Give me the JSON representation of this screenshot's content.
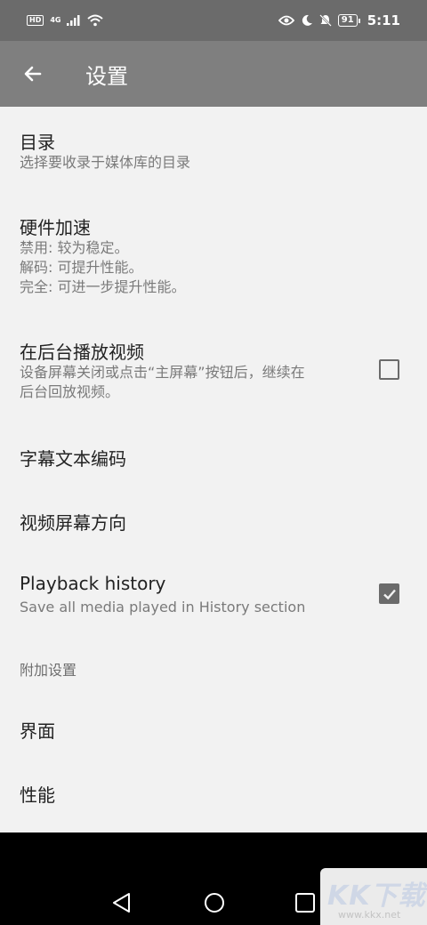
{
  "status_bar": {
    "hd": "HD",
    "network": "4G",
    "battery": "91",
    "time": "5:11"
  },
  "app_bar": {
    "title": "设置",
    "back_icon": "arrow-left-icon"
  },
  "preferences": {
    "directories": {
      "title": "目录",
      "summary": "选择要收录于媒体库的目录"
    },
    "hw_accel": {
      "title": "硬件加速",
      "summary_line1": "禁用: 较为稳定。",
      "summary_line2": "解码: 可提升性能。",
      "summary_line3": "完全: 可进一步提升性能。"
    },
    "background_play": {
      "title": "在后台播放视频",
      "summary_line1": "设备屏幕关闭或点击“主屏幕”按钮后，继续在",
      "summary_line2": "后台回放视频。",
      "checked": false
    },
    "subtitle_encoding": {
      "title": "字幕文本编码"
    },
    "screen_orientation": {
      "title": "视频屏幕方向"
    },
    "playback_history": {
      "title": "Playback history",
      "summary": "Save all media played in History section",
      "checked": true
    }
  },
  "extra_category": {
    "label": "附加设置"
  },
  "extra_items": {
    "interface": {
      "title": "界面"
    },
    "performance": {
      "title": "性能"
    }
  },
  "watermark": {
    "logo": "KK下载",
    "url": "www.kkx.net"
  },
  "colors": {
    "status_bar": "#6b6b6b",
    "app_bar": "#7f7f7f",
    "background": "#f2f2f2",
    "checkbox": "#6b6b6b"
  }
}
